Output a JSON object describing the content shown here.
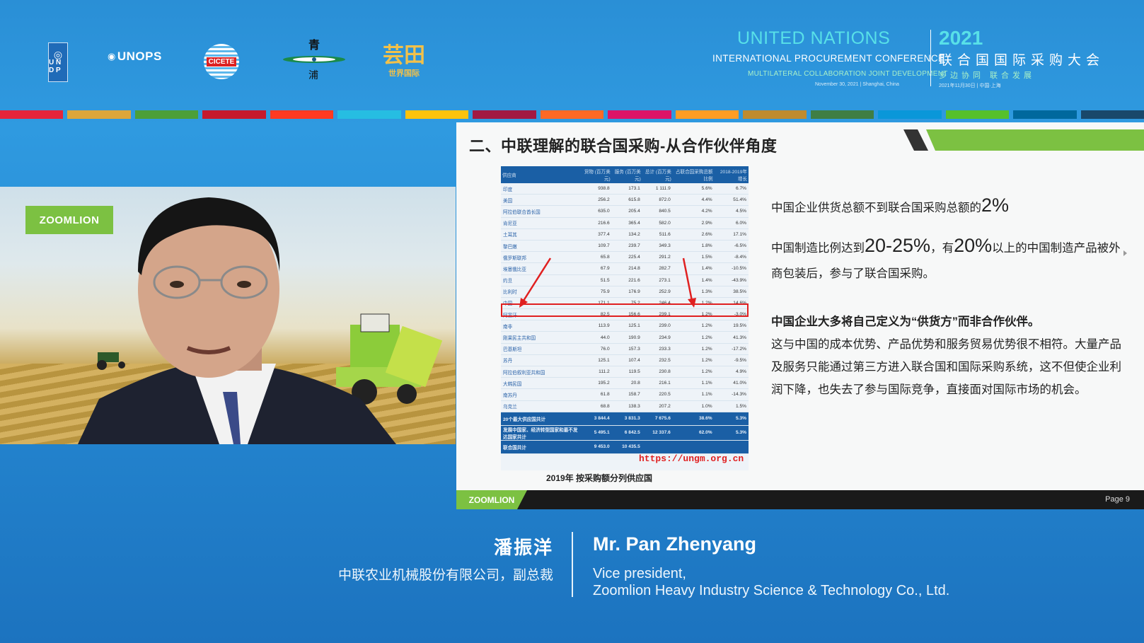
{
  "header": {
    "logos": {
      "undp": "U N D P",
      "unops": "UNOPS",
      "cicete": "CICETE",
      "qing": "青",
      "qing_sub": "浦",
      "zhi_big": "芸田",
      "zhi_sub": "世界国际"
    },
    "conference": {
      "en_line1": "UNITED NATIONS",
      "en_line2": "INTERNATIONAL PROCUREMENT CONFERENCE",
      "en_line3": "MULTILATERAL COLLABORATION   JOINT DEVELOPMENT",
      "en_line4": "November 30, 2021 | Shanghai, China",
      "year": "2021",
      "cn_line1": "联合国国际采购大会",
      "cn_line2": "多边协同  联合发展",
      "cn_line3": "2021年11月30日 | 中国·上海"
    },
    "sdg_colors": [
      "#e5243b",
      "#dda63a",
      "#4c9f38",
      "#c5192d",
      "#ff3a21",
      "#26bde2",
      "#fcc30b",
      "#a21942",
      "#fd6925",
      "#dd1367",
      "#fd9d24",
      "#bf8b2e",
      "#3f7e44",
      "#0a97d9",
      "#56c02b",
      "#00689d",
      "#19486a"
    ]
  },
  "video": {
    "brand": "ZOOMLION"
  },
  "slide": {
    "title": "二、中联理解的联合国采购-从合作伙伴角度",
    "table": {
      "headers": [
        "供应商",
        "货物 (百万美元)",
        "服务 (百万美元)",
        "总计 (百万美元)",
        "占联合国采购总额比例",
        "2018-2019年增长"
      ],
      "rows": [
        [
          "印度",
          "938.8",
          "173.1",
          "1 111.9",
          "5.6%",
          "6.7%"
        ],
        [
          "美国",
          "256.2",
          "615.8",
          "872.0",
          "4.4%",
          "51.4%"
        ],
        [
          "阿拉伯联合酋长国",
          "635.0",
          "205.4",
          "840.5",
          "4.2%",
          "4.5%"
        ],
        [
          "肯尼亚",
          "216.6",
          "365.4",
          "582.0",
          "2.9%",
          "6.0%"
        ],
        [
          "土耳其",
          "377.4",
          "134.2",
          "511.6",
          "2.6%",
          "17.1%"
        ],
        [
          "黎巴嫩",
          "109.7",
          "239.7",
          "349.3",
          "1.8%",
          "-6.5%"
        ],
        [
          "俄罗斯联邦",
          "65.8",
          "225.4",
          "291.2",
          "1.5%",
          "-8.4%"
        ],
        [
          "埃塞俄比亚",
          "67.9",
          "214.8",
          "282.7",
          "1.4%",
          "-10.5%"
        ],
        [
          "约旦",
          "51.5",
          "221.6",
          "273.1",
          "1.4%",
          "-43.9%"
        ],
        [
          "比利时",
          "75.9",
          "176.9",
          "252.9",
          "1.3%",
          "38.5%"
        ],
        [
          "中国",
          "171.1",
          "75.2",
          "246.4",
          "1.2%",
          "14.6%"
        ],
        [
          "阿富汗",
          "82.5",
          "156.6",
          "239.1",
          "1.2%",
          "-3.0%"
        ],
        [
          "南非",
          "113.9",
          "125.1",
          "239.0",
          "1.2%",
          "19.5%"
        ],
        [
          "刚果民主共和国",
          "44.0",
          "190.9",
          "234.9",
          "1.2%",
          "41.3%"
        ],
        [
          "巴基斯坦",
          "76.0",
          "157.3",
          "233.3",
          "1.2%",
          "-17.2%"
        ],
        [
          "苏丹",
          "125.1",
          "107.4",
          "232.5",
          "1.2%",
          "-9.5%"
        ],
        [
          "阿拉伯叙利亚共和国",
          "111.2",
          "119.5",
          "230.8",
          "1.2%",
          "4.9%"
        ],
        [
          "大韩民国",
          "195.2",
          "20.8",
          "216.1",
          "1.1%",
          "41.0%"
        ],
        [
          "南苏丹",
          "61.8",
          "158.7",
          "220.5",
          "1.1%",
          "-14.3%"
        ],
        [
          "乌克兰",
          "68.8",
          "138.3",
          "207.2",
          "1.0%",
          "1.5%"
        ]
      ],
      "sum_rows": [
        [
          "20个最大供应国共计",
          "3 844.4",
          "3 831.3",
          "7 675.6",
          "38.6%",
          "5.3%"
        ],
        [
          "发展中国家、经济转型国家和最不发达国家共计",
          "5 495.1",
          "6 842.5",
          "12 337.6",
          "62.0%",
          "5.3%"
        ],
        [
          "联合国共计",
          "9 453.0",
          "10 435.5",
          "",
          "",
          ""
        ]
      ]
    },
    "url": "https://ungm.org.cn",
    "caption": "2019年 按采购额分列供应国",
    "text1_pre": "中国企业供货总额不到联合国采购总额的",
    "text1_big": "2%",
    "text2_pre": "中国制造比例达到",
    "text2_big1": "20-25%",
    "text2_mid": "，有",
    "text2_big2": "20%",
    "text2_post": "以上的中国制造产品被外商包装后，参与了联合国采购。",
    "text3_bold": "中国企业大多将自己定义为“供货方”而非合作伙伴。",
    "text3_body": "这与中国的成本优势、产品优势和服务贸易优势很不相符。大量产品及服务只能通过第三方进入联合国和国际采购系统，这不但使企业利润下降，也失去了参与国际竞争，直接面对国际市场的机会。",
    "footer_brand": "ZOOMLION",
    "page": "Page 9"
  },
  "speaker": {
    "cn_name": "潘振洋",
    "cn_title": "中联农业机械股份有限公司，副总裁",
    "en_name": "Mr. Pan Zhenyang",
    "en_title1": "Vice president,",
    "en_title2": "Zoomlion Heavy Industry Science & Technology Co., Ltd."
  }
}
